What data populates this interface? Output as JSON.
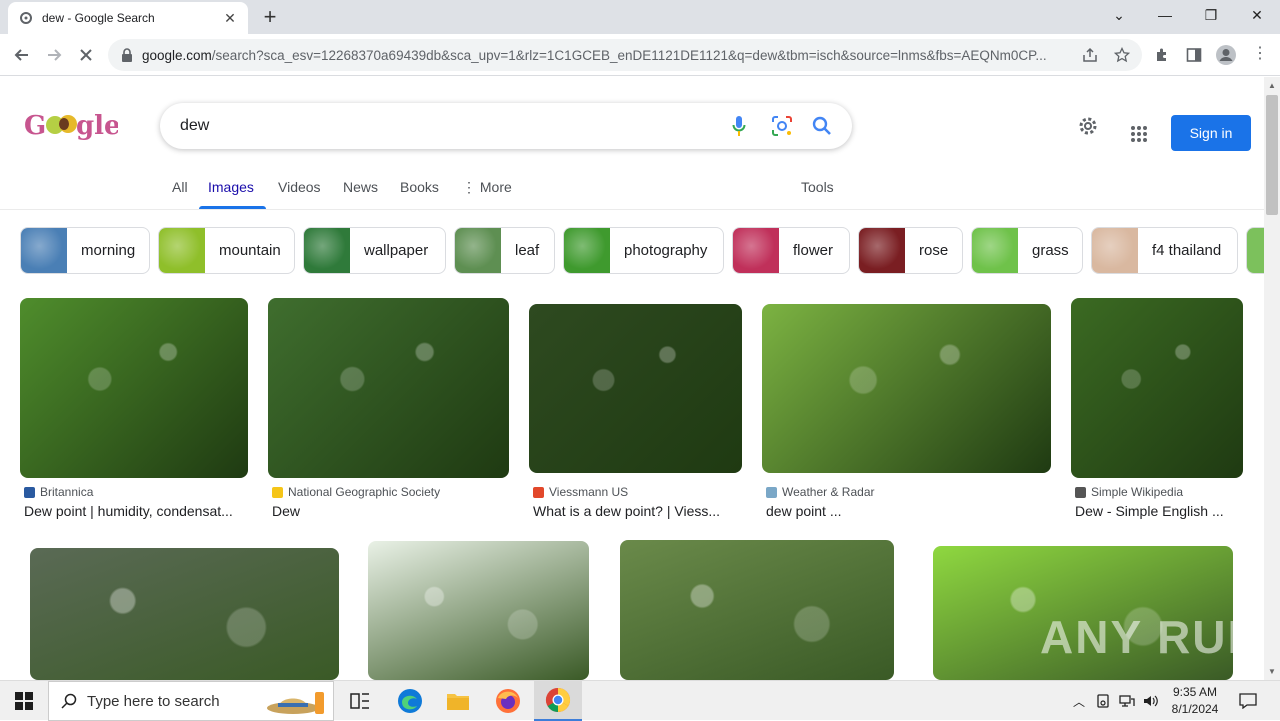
{
  "browser": {
    "tab_title": "dew - Google Search",
    "url_host": "google.com",
    "url_rest": "/search?sca_esv=12268370a69439db&sca_upv=1&rlz=1C1GCEB_enDE1121DE1121&q=dew&tbm=isch&source=lnms&fbs=AEQNm0CP..."
  },
  "search": {
    "query": "dew",
    "sign_in_label": "Sign in"
  },
  "nav_tabs": {
    "all": "All",
    "images": "Images",
    "videos": "Videos",
    "news": "News",
    "books": "Books",
    "more": "More",
    "tools": "Tools"
  },
  "chips": [
    {
      "label": "morning",
      "color": "#4a7fb5"
    },
    {
      "label": "mountain",
      "color": "#8fbf2a"
    },
    {
      "label": "wallpaper",
      "color": "#2f7a3a"
    },
    {
      "label": "leaf",
      "color": "#5e8f52"
    },
    {
      "label": "photography",
      "color": "#3f9a2e"
    },
    {
      "label": "flower",
      "color": "#c0305a"
    },
    {
      "label": "rose",
      "color": "#7a1e22"
    },
    {
      "label": "grass",
      "color": "#6fc24a"
    },
    {
      "label": "f4 thailand",
      "color": "#d9b8a0"
    }
  ],
  "results_row1": [
    {
      "source": "Britannica",
      "title": "Dew point | humidity, condensat...",
      "color": "#4f8d2c",
      "icon_color": "#2a5aa0"
    },
    {
      "source": "National Geographic Society",
      "title": "Dew",
      "color": "#3f6e2e",
      "icon_color": "#f5c518"
    },
    {
      "source": "Viessmann US",
      "title": "What is a dew point? | Viess...",
      "color": "#2e4a20",
      "icon_color": "#e2482b"
    },
    {
      "source": "Weather & Radar",
      "title": "dew point ...",
      "color": "#7cb342",
      "icon_color": "#7aa7c7"
    },
    {
      "source": "Simple Wikipedia",
      "title": "Dew - Simple English ...",
      "color": "#3b6a22",
      "icon_color": "#555555"
    }
  ],
  "results_row2": [
    {
      "color": "#5a6a55"
    },
    {
      "color": "#e9f1e6"
    },
    {
      "color": "#6a8a4a"
    },
    {
      "color": "#8fd840"
    }
  ],
  "taskbar": {
    "search_placeholder": "Type here to search",
    "time": "9:35 AM",
    "date": "8/1/2024"
  },
  "watermark": "ANY RUN"
}
